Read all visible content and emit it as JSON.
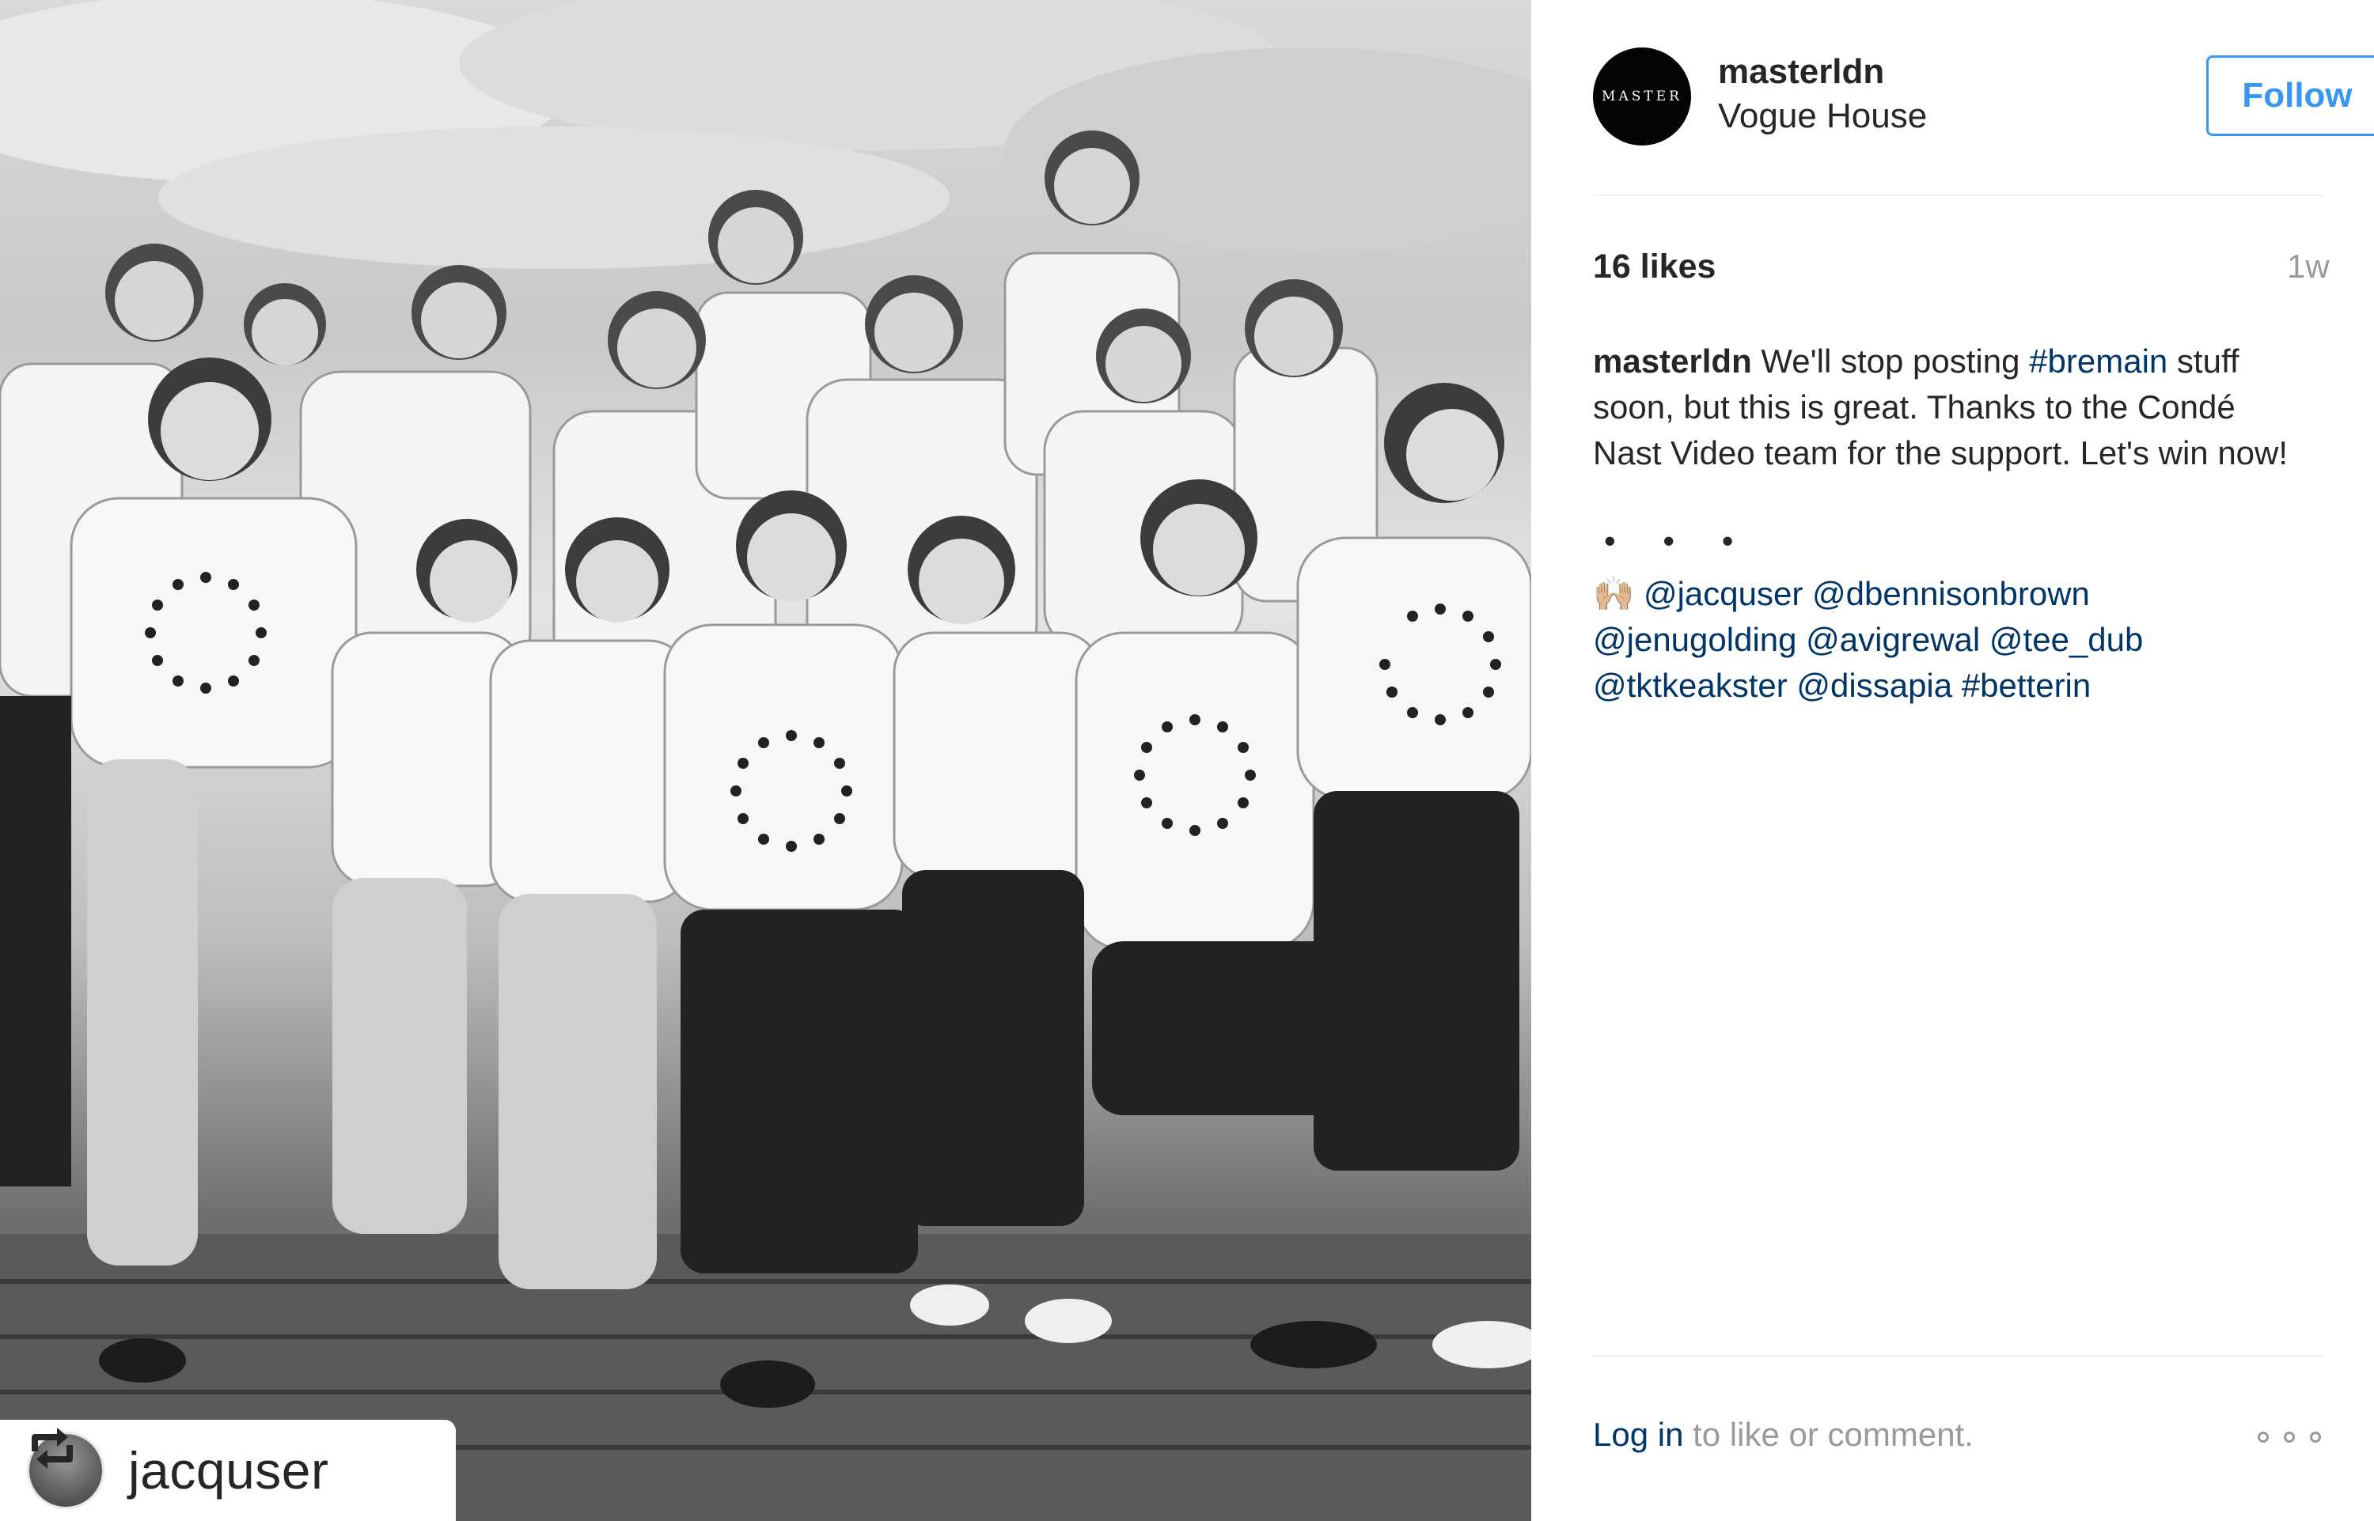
{
  "post": {
    "photo_alt": "Group of people wearing star-pattern t-shirts giving thumbs up",
    "repost": {
      "icon": "repost-icon",
      "username": "jacquser"
    }
  },
  "header": {
    "avatar_text": "MASTER",
    "username": "masterldn",
    "location": "Vogue House",
    "follow_label": "Follow"
  },
  "stats": {
    "likes": "16 likes",
    "time_ago": "1w"
  },
  "caption": {
    "username": "masterldn",
    "text_1": " We'll stop posting ",
    "hashtag_1": "#bremain",
    "text_2": " stuff soon, but this is great. Thanks to the Condé Nast Video team for the support. Let's win now!",
    "dots": "• • •",
    "emoji": "🙌🏼",
    "mentions": [
      "@jacquser",
      "@dbennisonbrown",
      "@jenugolding",
      "@avigrewal",
      "@tee_dub",
      "@tktkeakster",
      "@dissapia",
      "#betterin"
    ]
  },
  "footer": {
    "login_link": "Log in",
    "login_text": " to like or comment.",
    "more_icon": "more-options-icon"
  },
  "colors": {
    "follow_blue": "#3897f0",
    "link_navy": "#003569",
    "muted_gray": "#999999",
    "text": "#262626"
  }
}
